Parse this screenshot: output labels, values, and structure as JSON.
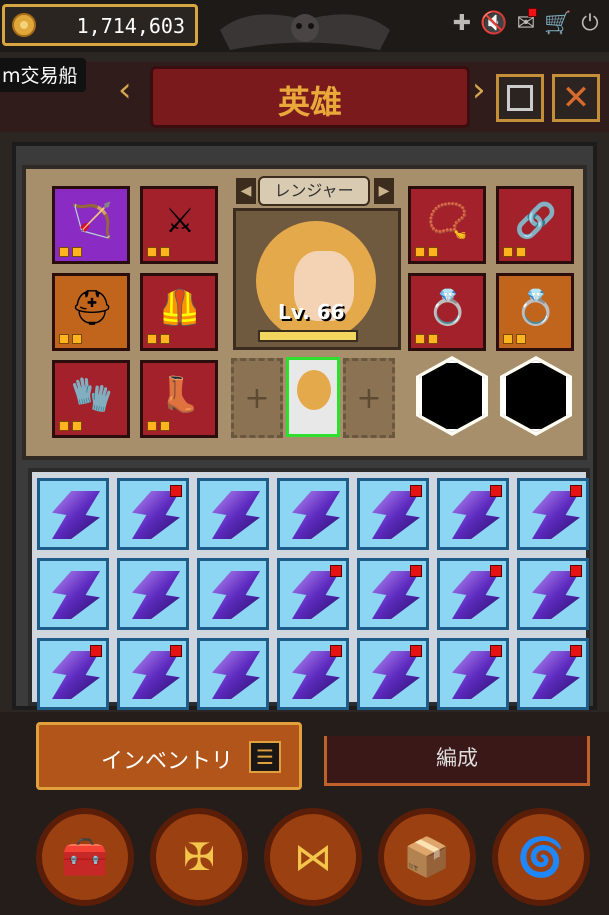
{
  "topbar": {
    "gold": "1,714,603",
    "icons": [
      "plus-icon",
      "mute-icon",
      "mail-icon",
      "cart-icon",
      "power-icon"
    ]
  },
  "tooltip": {
    "text": "m交易船"
  },
  "header": {
    "title": "英雄"
  },
  "hero": {
    "class_label": "レンジャー",
    "level": "Lv. 66",
    "add_slot_symbol": "+"
  },
  "tabs": {
    "inventory": "インベントリ",
    "formation": "編成"
  },
  "colors": {
    "accent": "#e9a83a",
    "item_bg": "#8cd6f4",
    "new_badge": "#e61212"
  }
}
